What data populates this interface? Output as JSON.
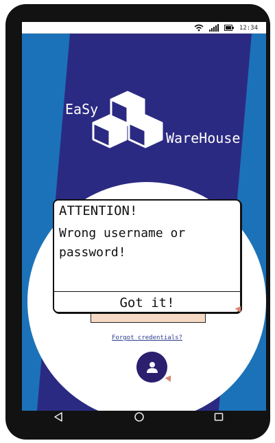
{
  "status_bar": {
    "time": "12:34",
    "icons": [
      "wifi-icon",
      "signal-icon",
      "battery-icon"
    ]
  },
  "logo": {
    "line1": "EaSy",
    "line2": "WareHouse",
    "icon": "boxes-icon"
  },
  "dialog": {
    "title": "ATTENTION!",
    "message": "Wrong username or password!",
    "button_label": "Got it!"
  },
  "forgot_link": "Forgot credentials?",
  "user_button": {
    "icon": "user-icon"
  },
  "nav": {
    "back": "back-icon",
    "home": "home-icon",
    "recents": "recents-icon"
  },
  "colors": {
    "background": "#2b2a82",
    "stripe": "#1c72b8",
    "user_button": "#2b1f6e",
    "accent": "#d98672",
    "peach": "#f5d9c4"
  }
}
